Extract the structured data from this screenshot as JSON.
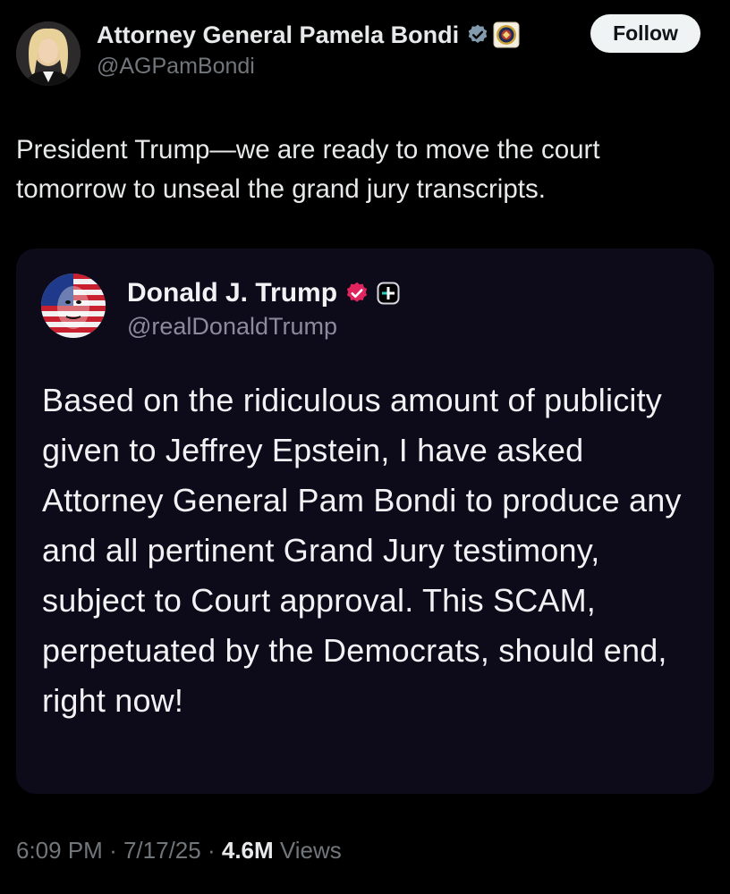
{
  "post": {
    "author": {
      "name": "Attorney General Pamela Bondi",
      "handle": "@AGPamBondi",
      "verified_badge": "verified-gray-icon",
      "affiliation_badge": "doj-seal-icon"
    },
    "follow_label": "Follow",
    "text": "President Trump—we are ready to move the court tomorrow to unseal the grand jury transcripts.",
    "quoted": {
      "author": {
        "name": "Donald J. Trump",
        "handle": "@realDonaldTrump",
        "verified_badge": "verified-pink-icon",
        "extra_badge": "plus-icon"
      },
      "text": "Based on the ridiculous amount of publicity given to Jeffrey Epstein, I have asked Attorney General Pam Bondi to produce any and all pertinent Grand Jury testimony, subject to Court approval. This SCAM, perpetuated by the Democrats, should end, right now!"
    },
    "meta": {
      "time": "6:09 PM",
      "separator": "·",
      "date": "7/17/25",
      "views_count": "4.6M",
      "views_label": "Views"
    }
  },
  "colors": {
    "background": "#000000",
    "text": "#e7e9ea",
    "muted": "#71767b",
    "follow_bg": "#eff3f4",
    "quote_card_bg": "#0d0b1a",
    "verified_pink": "#e0245e",
    "verified_gray": "#829aab"
  }
}
